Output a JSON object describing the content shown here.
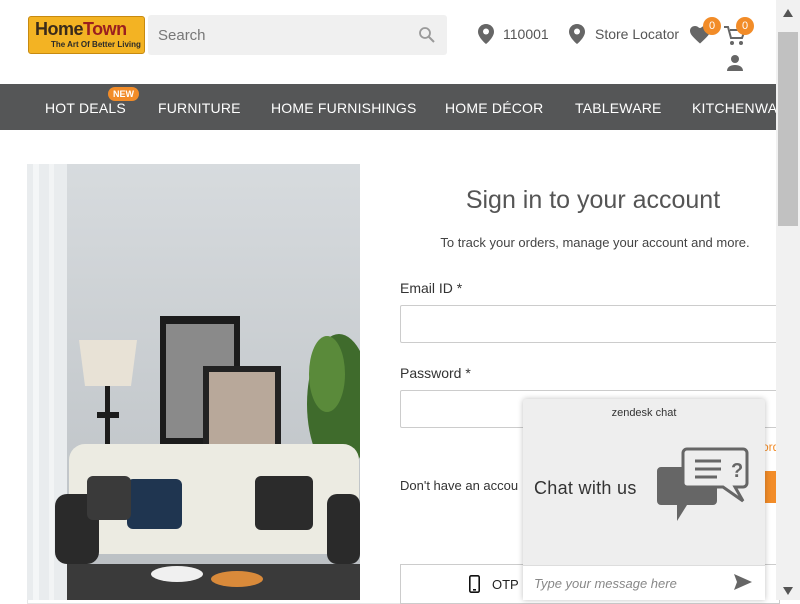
{
  "logo": {
    "brand_part1": "Home",
    "brand_part2": "Town",
    "tagline": "The Art Of Better Living"
  },
  "search": {
    "placeholder": "Search"
  },
  "header": {
    "pincode": "110001",
    "store_locator": "Store Locator",
    "wishlist_count": "0",
    "cart_count": "0"
  },
  "nav": {
    "new_badge": "NEW",
    "items": [
      "HOT DEALS",
      "FURNITURE",
      "HOME FURNISHINGS",
      "HOME DÉCOR",
      "TABLEWARE",
      "KITCHENWA"
    ]
  },
  "signin": {
    "title": "Sign in to your account",
    "subtitle": "To track your orders, manage your account and more.",
    "email_label": "Email ID *",
    "password_label": "Password *",
    "forgot_fragment": "ord",
    "no_account": "Don't have an accou",
    "otp_label": "OTP"
  },
  "chat": {
    "brand": "zendesk chat",
    "prompt": "Chat with us",
    "placeholder": "Type your message here"
  },
  "colors": {
    "accent": "#f28c28",
    "nav_bg": "#555657"
  }
}
